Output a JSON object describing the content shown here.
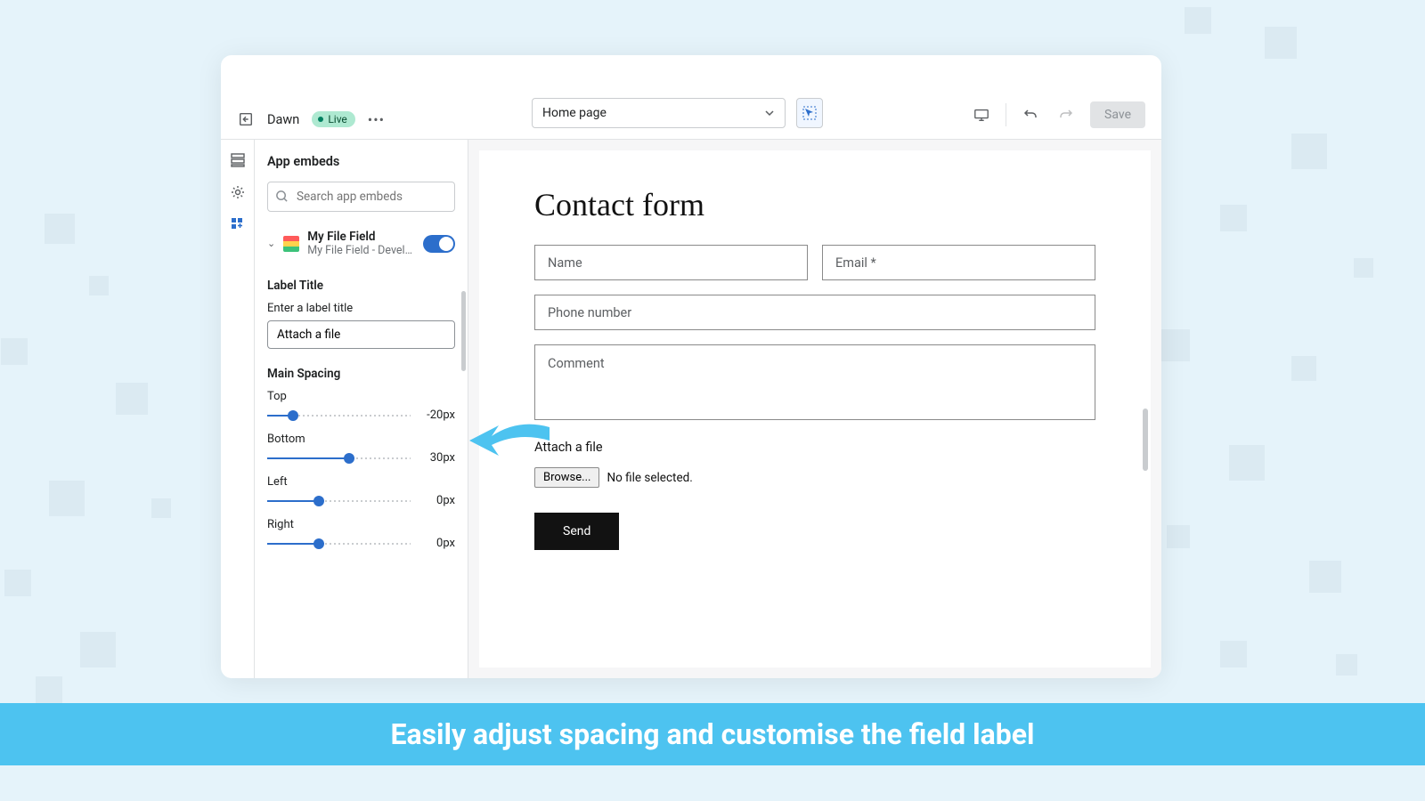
{
  "topbar": {
    "theme": "Dawn",
    "badge": "Live",
    "page_select": "Home page",
    "save": "Save"
  },
  "sidebar": {
    "title": "App embeds",
    "search_placeholder": "Search app embeds",
    "embed": {
      "name": "My File Field",
      "sub": "My File Field - Develop…"
    },
    "label_title": "Label Title",
    "enter_label": "Enter a label title",
    "label_value": "Attach a file",
    "main_spacing": "Main Spacing",
    "sliders": [
      {
        "label": "Top",
        "value": "-20px",
        "pct": 18
      },
      {
        "label": "Bottom",
        "value": "30px",
        "pct": 57
      },
      {
        "label": "Left",
        "value": "0px",
        "pct": 36
      },
      {
        "label": "Right",
        "value": "0px",
        "pct": 36
      }
    ]
  },
  "preview": {
    "title": "Contact form",
    "name": "Name",
    "email": "Email *",
    "phone": "Phone number",
    "comment": "Comment",
    "attach": "Attach a file",
    "browse": "Browse...",
    "nofile": "No file selected.",
    "send": "Send"
  },
  "banner": "Easily adjust spacing and customise the field label"
}
